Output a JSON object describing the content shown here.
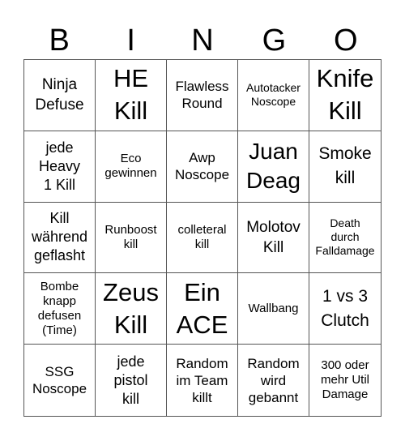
{
  "header": [
    "B",
    "I",
    "N",
    "G",
    "O"
  ],
  "cells": [
    {
      "text": "Ninja\nDefuse",
      "size": "s19"
    },
    {
      "text": "HE\nKill",
      "size": "s30"
    },
    {
      "text": "Flawless\nRound",
      "size": "s17"
    },
    {
      "text": "Autotacker\nNoscope",
      "size": "s14"
    },
    {
      "text": "Knife\nKill",
      "size": "s30"
    },
    {
      "text": "jede\nHeavy\n1 Kill",
      "size": "s18"
    },
    {
      "text": "Eco\ngewinnen",
      "size": "s15"
    },
    {
      "text": "Awp\nNoscope",
      "size": "s17"
    },
    {
      "text": "Juan\nDeag",
      "size": "s28"
    },
    {
      "text": "Smoke\nkill",
      "size": "s21"
    },
    {
      "text": "Kill\nwährend\ngeflasht",
      "size": "s18"
    },
    {
      "text": "Runboost\nkill",
      "size": "s15"
    },
    {
      "text": "colleteral\nkill",
      "size": "s15"
    },
    {
      "text": "Molotov\nKill",
      "size": "s19"
    },
    {
      "text": "Death\ndurch\nFalldamage",
      "size": "s14"
    },
    {
      "text": "Bombe\nknapp\ndefusen\n(Time)",
      "size": "s15"
    },
    {
      "text": "Zeus\nKill",
      "size": "s30"
    },
    {
      "text": "Ein\nACE",
      "size": "s30"
    },
    {
      "text": "Wallbang",
      "size": "s15"
    },
    {
      "text": "1 vs 3\nClutch",
      "size": "s21"
    },
    {
      "text": "SSG\nNoscope",
      "size": "s17"
    },
    {
      "text": "jede\npistol\nkill",
      "size": "s18"
    },
    {
      "text": "Random\nim Team\nkillt",
      "size": "s17"
    },
    {
      "text": "Random\nwird\ngebannt",
      "size": "s17"
    },
    {
      "text": "300 oder\nmehr Util\nDamage",
      "size": "s15"
    }
  ]
}
